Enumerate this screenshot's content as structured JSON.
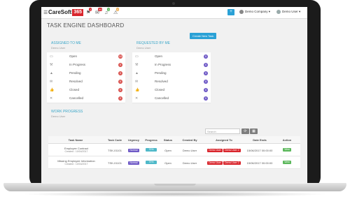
{
  "app": {
    "logo_main": "CareSoft",
    "logo_accent": "365"
  },
  "topbar": {
    "menu_icon": "hamburger-icon",
    "notifications": [
      {
        "icon": "flag-icon",
        "badge": "1",
        "color": "#d9262d"
      },
      {
        "icon": "mail-icon",
        "badge": "99",
        "color": "#d9262d"
      },
      {
        "icon": "bell-icon",
        "badge": "1",
        "color": "#5cb85c"
      },
      {
        "icon": "alert-icon",
        "badge": "0",
        "color": "#f0ad4e"
      }
    ],
    "add_label": "+",
    "company_label": "Demo Company",
    "user_label": "Demo User"
  },
  "page": {
    "title": "TASK ENGINE DASHBOARD",
    "create_button": "Create New Task"
  },
  "assigned": {
    "heading": "ASSIGNED TO ME",
    "subtitle": "Demo User",
    "rows": [
      {
        "icon": "folder-icon",
        "label": "Open",
        "count": "10",
        "color": "#d9534f"
      },
      {
        "icon": "tools-icon",
        "label": "In Progress",
        "count": "0",
        "color": "#d9534f"
      },
      {
        "icon": "warning-icon",
        "label": "Pending",
        "count": "0",
        "color": "#d9534f"
      },
      {
        "icon": "envelope-icon",
        "label": "Resolved",
        "count": "0",
        "color": "#d9534f"
      },
      {
        "icon": "thumbsup-icon",
        "label": "Closed",
        "count": "0",
        "color": "#d9534f"
      },
      {
        "icon": "cross-icon",
        "label": "Cancelled",
        "count": "0",
        "color": "#d9534f"
      }
    ]
  },
  "requested": {
    "heading": "REQUESTED BY ME",
    "subtitle": "Demo User",
    "rows": [
      {
        "icon": "folder-icon",
        "label": "Open",
        "count": "0",
        "color": "#6f5ac6"
      },
      {
        "icon": "tools-icon",
        "label": "In Progress",
        "count": "0",
        "color": "#6f5ac6"
      },
      {
        "icon": "warning-icon",
        "label": "Pending",
        "count": "0",
        "color": "#6f5ac6"
      },
      {
        "icon": "envelope-icon",
        "label": "Resolved",
        "count": "0",
        "color": "#6f5ac6"
      },
      {
        "icon": "thumbsup-icon",
        "label": "Closed",
        "count": "0",
        "color": "#6f5ac6"
      },
      {
        "icon": "cross-icon",
        "label": "Cancelled",
        "count": "0",
        "color": "#6f5ac6"
      }
    ]
  },
  "work": {
    "heading": "WORK PROGRESS",
    "subtitle": "Demo User"
  },
  "table": {
    "search_placeholder": "Search",
    "headers": [
      "Task Name",
      "Task Code",
      "Urgency",
      "Progress",
      "Status",
      "Created By",
      "Assigned To",
      "Date Ends",
      "Action"
    ],
    "rows": [
      {
        "name": "Employee Contract",
        "created": "Created : 10/04/2017",
        "code": "TSK-01101",
        "urgency": "Normal",
        "progress": "70%",
        "status": "Open",
        "created_by": "Demo User",
        "assigned": [
          "Demo User",
          "Demo User 2"
        ],
        "date_ends": "15/06/2017 00:00:00",
        "action": "View"
      },
      {
        "name": "Missing Employee Information",
        "created": "Created : 10/04/2017",
        "code": "TSK-01101",
        "urgency": "Normal",
        "progress": "70%",
        "status": "Open",
        "created_by": "Demo User",
        "assigned": [
          "Demo User",
          "Demo User 2"
        ],
        "date_ends": "15/06/2017 00:00:00",
        "action": "View"
      }
    ]
  },
  "colors": {
    "accent": "#2aa1d6",
    "danger": "#d9262d",
    "purple": "#6f5ac6",
    "success": "#5cb85c",
    "progress": "#4fb9c9"
  }
}
